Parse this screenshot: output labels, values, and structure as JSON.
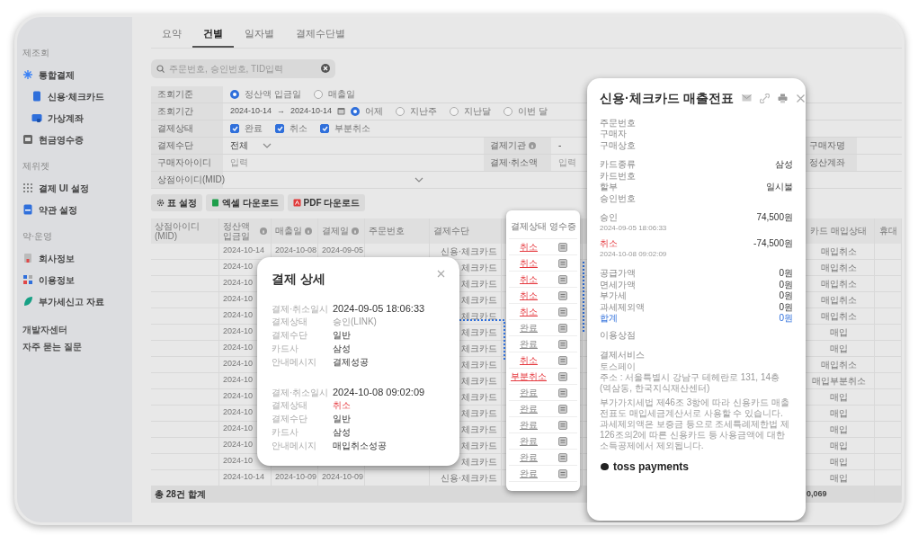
{
  "sidebar": {
    "groups": [
      {
        "title": "제조회",
        "items": [
          {
            "label": "통합결제",
            "children": [
              {
                "label": "신용·체크카드"
              },
              {
                "label": "가상계좌"
              }
            ]
          },
          {
            "label": "현금영수증"
          }
        ]
      },
      {
        "title": "제위젯",
        "items": [
          {
            "label": "결제 UI 설정"
          },
          {
            "label": "약관 설정"
          }
        ]
      },
      {
        "title": "약·운영",
        "items": [
          {
            "label": "회사정보"
          },
          {
            "label": "이용정보"
          },
          {
            "label": "부가세신고 자료"
          }
        ]
      }
    ],
    "links": [
      "개발자센터",
      "자주 묻는 질문"
    ]
  },
  "tabs": [
    {
      "label": "요약",
      "selected": false
    },
    {
      "label": "건별",
      "selected": true
    },
    {
      "label": "일자별",
      "selected": false
    },
    {
      "label": "결제수단별",
      "selected": false
    }
  ],
  "search": {
    "placeholder": "주문번호, 승인번호, TID입력"
  },
  "filters": {
    "criteria": {
      "label": "조회기준",
      "options": [
        {
          "label": "정산액 입금일",
          "selected": true
        },
        {
          "label": "매출일",
          "selected": false
        }
      ]
    },
    "period": {
      "label": "조회기간",
      "from": "2024-10-14",
      "arrow": "→",
      "to": "2024-10-14",
      "presets": [
        {
          "label": "어제",
          "selected": true
        },
        {
          "label": "지난주",
          "selected": false
        },
        {
          "label": "지난달",
          "selected": false
        },
        {
          "label": "이번 달",
          "selected": false
        }
      ]
    },
    "status": {
      "label": "결제상태",
      "options": [
        {
          "label": "완료",
          "checked": true
        },
        {
          "label": "취소",
          "checked": true
        },
        {
          "label": "부분취소",
          "checked": true
        }
      ]
    },
    "method": {
      "label": "결제수단",
      "value": "전체",
      "institution_label": "결제기관",
      "institution_value": "-",
      "buyer_name_label": "구매자명"
    },
    "buyer_id": {
      "label": "구매자아이디",
      "placeholder": "입력",
      "amount_label": "결제·취소액",
      "amount_placeholder": "입력",
      "account_label": "정산계좌"
    },
    "mid": {
      "label": "상점아이디(MID)"
    }
  },
  "toolbar": {
    "buttons": [
      "표 설정",
      "엑셀 다운로드",
      "PDF 다운로드"
    ]
  },
  "table": {
    "columns": [
      {
        "label": "상점아이디(MID)",
        "info": false
      },
      {
        "label": "정산액 입금일",
        "info": true
      },
      {
        "label": "매출일",
        "info": true
      },
      {
        "label": "결제일",
        "info": true
      },
      {
        "label": "주문번호",
        "info": false
      },
      {
        "label": "결제수단",
        "info": false
      }
    ],
    "right_columns": [
      "카드 매입상태",
      "휴대"
    ],
    "rows": [
      {
        "settle": "2024-10-14",
        "sales": "2024-10-08",
        "paid": "2024-09-05",
        "method": "신용·체크카드",
        "purchase": "매입취소"
      },
      {
        "settle": "2024-10",
        "method": "체크카드",
        "purchase": "매입취소"
      },
      {
        "settle": "2024-10",
        "method": "체크카드",
        "purchase": "매입취소"
      },
      {
        "settle": "2024-10",
        "method": "체크카드",
        "purchase": "매입취소"
      },
      {
        "settle": "2024-10",
        "method": "체크카드",
        "purchase": "매입취소"
      },
      {
        "settle": "2024-10",
        "method": "체크카드",
        "purchase": "매입"
      },
      {
        "settle": "2024-10",
        "method": "체크카드",
        "purchase": "매입"
      },
      {
        "settle": "2024-10",
        "method": "체크카드",
        "purchase": "매입취소"
      },
      {
        "settle": "2024-10",
        "method": "체크카드",
        "purchase": "매입부분취소"
      },
      {
        "settle": "2024-10",
        "method": "체크카드",
        "purchase": "매입"
      },
      {
        "settle": "2024-10",
        "method": "체크카드",
        "purchase": "매입"
      },
      {
        "settle": "2024-10",
        "method": "체크카드",
        "purchase": "매입"
      },
      {
        "settle": "2024-10",
        "method": "체크카드",
        "purchase": "매입"
      },
      {
        "settle": "2024-10",
        "method": "체크카드",
        "purchase": "매입"
      },
      {
        "settle": "2024-10-14",
        "sales": "2024-10-09",
        "paid": "2024-10-09",
        "method": "신용·체크카드",
        "purchase": "매입"
      }
    ],
    "footer": {
      "label": "총 28건 합계",
      "amount": "0,069"
    }
  },
  "status_popout": {
    "columns": [
      "결제상태",
      "영수증"
    ],
    "rows": [
      {
        "label": "취소",
        "kind": "cancel"
      },
      {
        "label": "취소",
        "kind": "cancel"
      },
      {
        "label": "취소",
        "kind": "cancel"
      },
      {
        "label": "취소",
        "kind": "cancel"
      },
      {
        "label": "취소",
        "kind": "cancel"
      },
      {
        "label": "완료",
        "kind": "done"
      },
      {
        "label": "완료",
        "kind": "done"
      },
      {
        "label": "취소",
        "kind": "cancel"
      },
      {
        "label": "부분취소",
        "kind": "cancel"
      },
      {
        "label": "완료",
        "kind": "done"
      },
      {
        "label": "완료",
        "kind": "done"
      },
      {
        "label": "완료",
        "kind": "done"
      },
      {
        "label": "완료",
        "kind": "done"
      },
      {
        "label": "완료",
        "kind": "done"
      },
      {
        "label": "완료",
        "kind": "done"
      }
    ]
  },
  "payment_detail": {
    "title": "결제 상세",
    "sections": [
      {
        "rows": [
          {
            "label": "결제·취소일시",
            "value": "2024-09-05 18:06:33",
            "kind": "time"
          },
          {
            "label": "결제상태",
            "value": "승인(LINK)",
            "kind": "muted"
          },
          {
            "label": "결제수단",
            "value": "일반",
            "kind": "plain"
          },
          {
            "label": "카드사",
            "value": "삼성",
            "kind": "plain"
          },
          {
            "label": "안내메시지",
            "value": "결제성공",
            "kind": "plain"
          }
        ]
      },
      {
        "rows": [
          {
            "label": "결제·취소일시",
            "value": "2024-10-08 09:02:09",
            "kind": "time"
          },
          {
            "label": "결제상태",
            "value": "취소",
            "kind": "cancel"
          },
          {
            "label": "결제수단",
            "value": "일반",
            "kind": "plain"
          },
          {
            "label": "카드사",
            "value": "삼성",
            "kind": "plain"
          },
          {
            "label": "안내메시지",
            "value": "매입취소성공",
            "kind": "plain"
          }
        ]
      }
    ]
  },
  "receipt": {
    "title": "신용·체크카드 매출전표",
    "order_rows": [
      {
        "label": "주문번호"
      },
      {
        "label": "구매자"
      },
      {
        "label": "구매상호"
      }
    ],
    "card_rows": [
      {
        "label": "카드종류",
        "value": "삼성"
      },
      {
        "label": "카드번호"
      },
      {
        "label": "할부",
        "value": "일시불"
      },
      {
        "label": "승인번호"
      }
    ],
    "transactions": [
      {
        "label": "승인",
        "amount": "74,500원",
        "time": "2024-09-05 18:06:33",
        "kind": "approve"
      },
      {
        "label": "취소",
        "amount": "-74,500원",
        "time": "2024-10-08 09:02:09",
        "kind": "cancel"
      }
    ],
    "amount_rows": [
      {
        "label": "공급가액",
        "value": "0원",
        "kind": "plain"
      },
      {
        "label": "면세가액",
        "value": "0원",
        "kind": "plain"
      },
      {
        "label": "부가세",
        "value": "0원",
        "kind": "plain"
      },
      {
        "label": "과세제외액",
        "value": "0원",
        "kind": "plain"
      },
      {
        "label": "합계",
        "value": "0원",
        "kind": "total"
      }
    ],
    "merchant_label": "이용상점",
    "provider": {
      "label": "결제서비스",
      "name": "토스페이",
      "address": "주소 : 서울특별시 강남구 테헤란로 131, 14층 (역삼동, 한국지식재산센터)"
    },
    "notice": "부가가치세법 제46조 3항에 따라 신용카드 매출전표도 매입세금계산서로 사용할 수 있습니다. 과세제외액은 보증금 등으로 조세특례제한법 제126조의2에 따른 신용카드 등 사용금액에 대한 소득공제에서 제외됩니다.",
    "logo": "toss payments"
  }
}
